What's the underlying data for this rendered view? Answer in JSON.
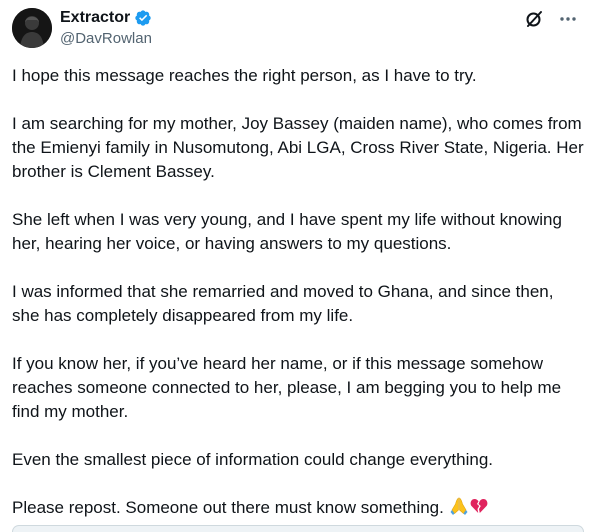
{
  "author": {
    "display_name": "Extractor",
    "handle": "@DavRowlan",
    "verified": true
  },
  "icons": {
    "avatar": "avatar-silhouette",
    "verified": "verified-badge-icon",
    "grok": "grok-icon",
    "more": "more-icon",
    "pray": "folded-hands-emoji",
    "heart": "broken-heart-emoji"
  },
  "colors": {
    "text": "#0f1419",
    "secondary": "#536471",
    "verified_blue": "#1d9bf0"
  },
  "post": {
    "paragraphs": [
      "I hope this message reaches the right person, as I have to try.",
      "I am searching for my mother, Joy Bassey (maiden name), who comes from the Emienyi family in Nusomutong, Abi LGA, Cross River State, Nigeria. Her brother is Clement Bassey.",
      "She left when I was very young, and I have spent my life without knowing her, hearing her voice, or having answers to my questions.",
      "I was informed that she remarried and moved to Ghana, and since then, she has completely disappeared from my life.",
      "If you know her, if you’ve heard her name, or if this message somehow reaches someone connected to her, please, I am begging you to help me find my mother.",
      "Even the smallest piece of information could change everything.",
      "Please repost. Someone out there must know something."
    ]
  }
}
